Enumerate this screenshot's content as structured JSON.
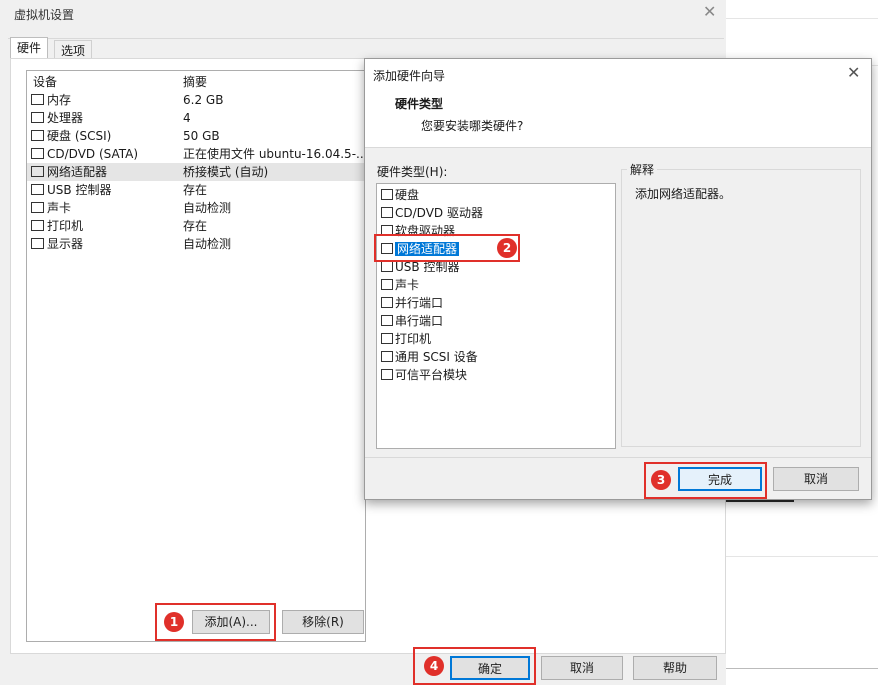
{
  "main": {
    "title": "虚拟机设置",
    "tabs": [
      "硬件",
      "选项"
    ],
    "columns": {
      "device": "设备",
      "summary": "摘要"
    },
    "devices": [
      {
        "name": "内存",
        "summary": "6.2 GB",
        "icon": "memory-icon"
      },
      {
        "name": "处理器",
        "summary": "4",
        "icon": "cpu-icon"
      },
      {
        "name": "硬盘 (SCSI)",
        "summary": "50 GB",
        "icon": "disk-icon"
      },
      {
        "name": "CD/DVD (SATA)",
        "summary": "正在使用文件 ubuntu-16.04.5-...",
        "icon": "cd-icon"
      },
      {
        "name": "网络适配器",
        "summary": "桥接模式 (自动)",
        "icon": "network-icon",
        "selected": true
      },
      {
        "name": "USB 控制器",
        "summary": "存在",
        "icon": "usb-icon"
      },
      {
        "name": "声卡",
        "summary": "自动检测",
        "icon": "sound-icon"
      },
      {
        "name": "打印机",
        "summary": "存在",
        "icon": "printer-icon"
      },
      {
        "name": "显示器",
        "summary": "自动检测",
        "icon": "display-icon"
      }
    ],
    "add_button": "添加(A)...",
    "remove_button": "移除(R)",
    "ok_button": "确定",
    "cancel_button": "取消",
    "help_button": "帮助"
  },
  "wizard": {
    "title": "添加硬件向导",
    "heading": "硬件类型",
    "subheading": "您要安装哪类硬件?",
    "list_label": "硬件类型(H):",
    "items": [
      {
        "name": "硬盘",
        "icon": "disk-icon"
      },
      {
        "name": "CD/DVD 驱动器",
        "icon": "cd-icon"
      },
      {
        "name": "软盘驱动器",
        "icon": "floppy-icon"
      },
      {
        "name": "网络适配器",
        "icon": "network-icon",
        "selected": true
      },
      {
        "name": "USB 控制器",
        "icon": "usb-icon"
      },
      {
        "name": "声卡",
        "icon": "sound-icon"
      },
      {
        "name": "并行端口",
        "icon": "parallel-port-icon"
      },
      {
        "name": "串行端口",
        "icon": "serial-port-icon"
      },
      {
        "name": "打印机",
        "icon": "printer-icon"
      },
      {
        "name": "通用 SCSI 设备",
        "icon": "scsi-icon"
      },
      {
        "name": "可信平台模块",
        "icon": "tpm-icon"
      }
    ],
    "explanation_label": "解释",
    "explanation": "添加网络适配器。",
    "finish_button": "完成",
    "cancel_button": "取消"
  },
  "callouts": [
    "1",
    "2",
    "3",
    "4"
  ],
  "colors": {
    "highlight": "#e0302a",
    "selection": "#0078d7"
  }
}
